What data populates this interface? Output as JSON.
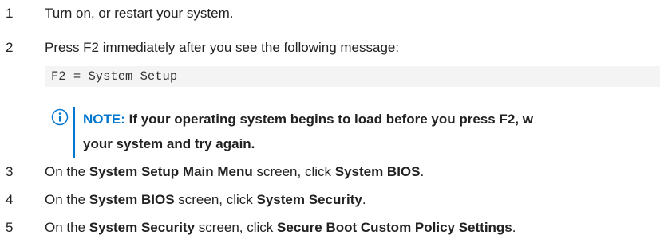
{
  "steps": [
    {
      "num": "1",
      "parts": [
        {
          "text": "Turn on, or restart your system.",
          "bold": false
        }
      ]
    },
    {
      "num": "2",
      "parts": [
        {
          "text": "Press F2 immediately after you see the following message:",
          "bold": false
        }
      ]
    },
    {
      "num": "3",
      "parts": [
        {
          "text": "On the ",
          "bold": false
        },
        {
          "text": "System Setup Main Menu",
          "bold": true
        },
        {
          "text": " screen, click ",
          "bold": false
        },
        {
          "text": "System BIOS",
          "bold": true
        },
        {
          "text": ".",
          "bold": false
        }
      ]
    },
    {
      "num": "4",
      "parts": [
        {
          "text": "On the ",
          "bold": false
        },
        {
          "text": "System BIOS",
          "bold": true
        },
        {
          "text": " screen, click ",
          "bold": false
        },
        {
          "text": "System Security",
          "bold": true
        },
        {
          "text": ".",
          "bold": false
        }
      ]
    },
    {
      "num": "5",
      "parts": [
        {
          "text": "On the ",
          "bold": false
        },
        {
          "text": "System Security",
          "bold": true
        },
        {
          "text": " screen, click ",
          "bold": false
        },
        {
          "text": "Secure Boot Custom Policy Settings",
          "bold": true
        },
        {
          "text": ".",
          "bold": false
        }
      ]
    }
  ],
  "code": "F2 = System Setup",
  "note": {
    "label": "NOTE:",
    "line1": " If your operating system begins to load before you press F2, w",
    "line2": "your system and try again.",
    "icon": "info-icon",
    "accent_color": "#0076ce"
  }
}
